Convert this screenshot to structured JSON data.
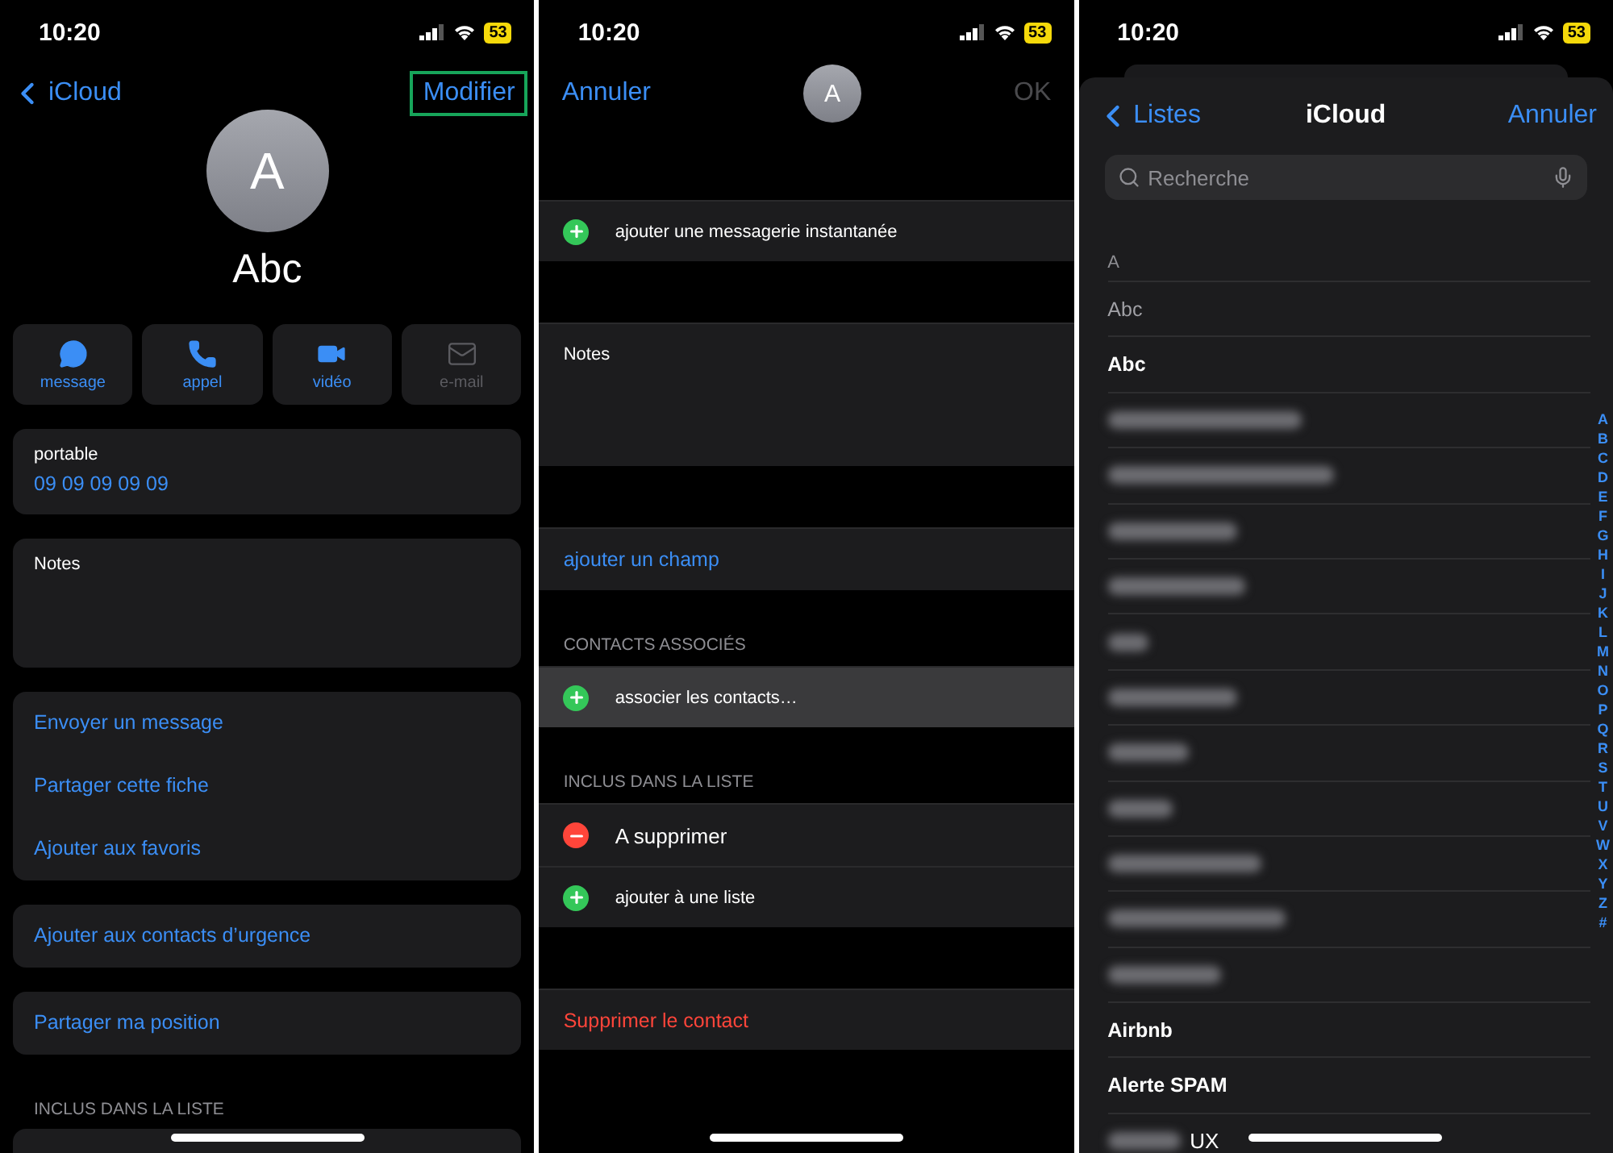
{
  "contact_screen": {
    "status_bar": {
      "time": "10:20",
      "battery": "53"
    },
    "nav": {
      "back": "iCloud",
      "action": "Modifier",
      "action_highlighted": true
    },
    "avatar_initial": "A",
    "name": "Abc",
    "actions": [
      {
        "label": "message",
        "kind": "message",
        "disabled": false
      },
      {
        "label": "appel",
        "kind": "phone",
        "disabled": false
      },
      {
        "label": "vidéo",
        "kind": "video",
        "disabled": false
      },
      {
        "label": "e-mail",
        "kind": "mail",
        "disabled": true
      }
    ],
    "phone": {
      "label": "portable",
      "value": "09 09 09 09 09"
    },
    "notes_label": "Notes",
    "link_groups": [
      [
        "Envoyer un message",
        "Partager cette fiche",
        "Ajouter aux favoris"
      ],
      [
        "Ajouter aux contacts d’urgence"
      ],
      [
        "Partager ma position"
      ]
    ],
    "section_header": "INCLUS DANS LA LISTE"
  },
  "edit_screen": {
    "status_bar": {
      "time": "10:20",
      "battery": "53"
    },
    "nav": {
      "cancel": "Annuler",
      "avatar_initial": "A",
      "done": "OK",
      "done_disabled": true
    },
    "groups": [
      {
        "rows": [
          {
            "kind": "add",
            "text": "ajouter une messagerie instantanée",
            "highlighted": false
          }
        ]
      },
      {
        "rows": [
          {
            "kind": "notes",
            "text": "Notes",
            "highlighted": false
          }
        ]
      },
      {
        "rows": [
          {
            "kind": "link",
            "text": "ajouter un champ",
            "highlighted": false
          }
        ]
      },
      {
        "header": "CONTACTS ASSOCIÉS",
        "rows": [
          {
            "kind": "add",
            "text": "associer les contacts…",
            "highlighted": true
          }
        ]
      },
      {
        "header": "INCLUS DANS LA LISTE",
        "rows": [
          {
            "kind": "remove",
            "text": "A supprimer",
            "highlighted": false
          },
          {
            "kind": "add",
            "text": "ajouter à une liste",
            "highlighted": false
          }
        ]
      },
      {
        "rows": [
          {
            "kind": "destructive",
            "text": "Supprimer le contact",
            "highlighted": false
          }
        ]
      }
    ]
  },
  "list_screen": {
    "status_bar": {
      "time": "10:20",
      "battery": "53"
    },
    "nav": {
      "back": "Listes",
      "title": "iCloud",
      "cancel": "Annuler"
    },
    "search": {
      "placeholder": "Recherche"
    },
    "section": "A",
    "rows": [
      {
        "kind": "name",
        "text": "Abc",
        "disabled": true
      },
      {
        "kind": "name",
        "text": "Abc",
        "disabled": false
      },
      {
        "kind": "blurred"
      },
      {
        "kind": "blurred"
      },
      {
        "kind": "blurred"
      },
      {
        "kind": "blurred"
      },
      {
        "kind": "blurred"
      },
      {
        "kind": "blurred"
      },
      {
        "kind": "blurred"
      },
      {
        "kind": "blurred"
      },
      {
        "kind": "blurred"
      },
      {
        "kind": "blurred"
      },
      {
        "kind": "blurred"
      },
      {
        "kind": "name",
        "text": "Airbnb",
        "disabled": false
      },
      {
        "kind": "name",
        "text": "Alerte SPAM",
        "disabled": false
      },
      {
        "kind": "blurred",
        "text": "UX"
      }
    ],
    "index": [
      "A",
      "B",
      "C",
      "D",
      "E",
      "F",
      "G",
      "H",
      "I",
      "J",
      "K",
      "L",
      "M",
      "N",
      "O",
      "P",
      "Q",
      "R",
      "S",
      "T",
      "U",
      "V",
      "W",
      "X",
      "Y",
      "Z",
      "#"
    ]
  }
}
